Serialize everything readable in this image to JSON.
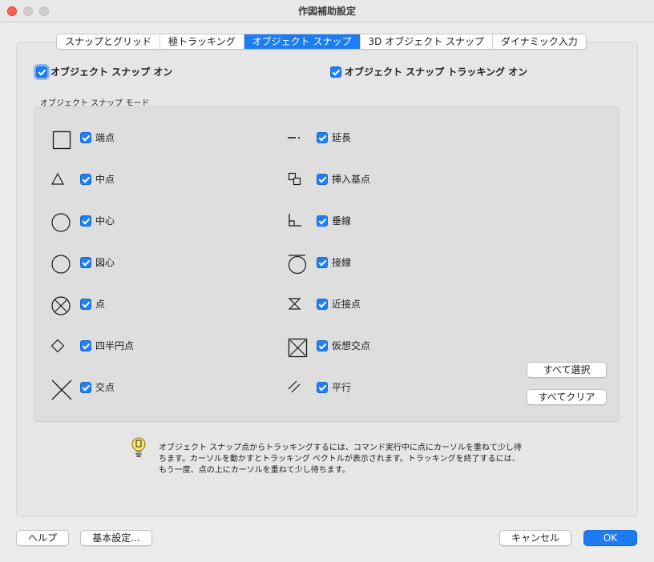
{
  "window": {
    "title": "作図補助設定"
  },
  "tabs": [
    {
      "label": "スナップとグリッド",
      "active": false
    },
    {
      "label": "極トラッキング",
      "active": false
    },
    {
      "label": "オブジェクト スナップ",
      "active": true
    },
    {
      "label": "3D オブジェクト スナップ",
      "active": false
    },
    {
      "label": "ダイナミック入力",
      "active": false
    }
  ],
  "options": {
    "osnap_on": {
      "label": "オブジェクト スナップ オン",
      "checked": true
    },
    "osnap_tracking_on": {
      "label": "オブジェクト スナップ トラッキング オン",
      "checked": true
    }
  },
  "modes": {
    "title": "オブジェクト スナップ モード",
    "left": [
      {
        "label": "端点",
        "icon": "endpoint-icon",
        "checked": true
      },
      {
        "label": "中点",
        "icon": "midpoint-icon",
        "checked": true
      },
      {
        "label": "中心",
        "icon": "center-icon",
        "checked": true
      },
      {
        "label": "図心",
        "icon": "centroid-icon",
        "checked": true
      },
      {
        "label": "点",
        "icon": "node-icon",
        "checked": true
      },
      {
        "label": "四半円点",
        "icon": "quadrant-icon",
        "checked": true
      },
      {
        "label": "交点",
        "icon": "intersection-icon",
        "checked": true
      }
    ],
    "right": [
      {
        "label": "延長",
        "icon": "extension-icon",
        "checked": true
      },
      {
        "label": "挿入基点",
        "icon": "insertion-icon",
        "checked": true
      },
      {
        "label": "垂線",
        "icon": "perpendicular-icon",
        "checked": true
      },
      {
        "label": "接線",
        "icon": "tangent-icon",
        "checked": true
      },
      {
        "label": "近接点",
        "icon": "nearest-icon",
        "checked": true
      },
      {
        "label": "仮想交点",
        "icon": "apparent-intersection-icon",
        "checked": true
      },
      {
        "label": "平行",
        "icon": "parallel-icon",
        "checked": true
      }
    ],
    "select_all": "すべて選択",
    "clear_all": "すべてクリア"
  },
  "info": {
    "icon": "lightbulb-icon",
    "text": "オブジェクト スナップ点からトラッキングするには、コマンド実行中に点にカーソルを重ねて少し待ちます。カーソルを動かすとトラッキング ベクトルが表示されます。トラッキングを終了するには、もう一度、点の上にカーソルを重ねて少し待ちます。"
  },
  "footer": {
    "help": "ヘルプ",
    "basic_settings": "基本設定...",
    "cancel": "キャンセル",
    "ok": "OK"
  }
}
